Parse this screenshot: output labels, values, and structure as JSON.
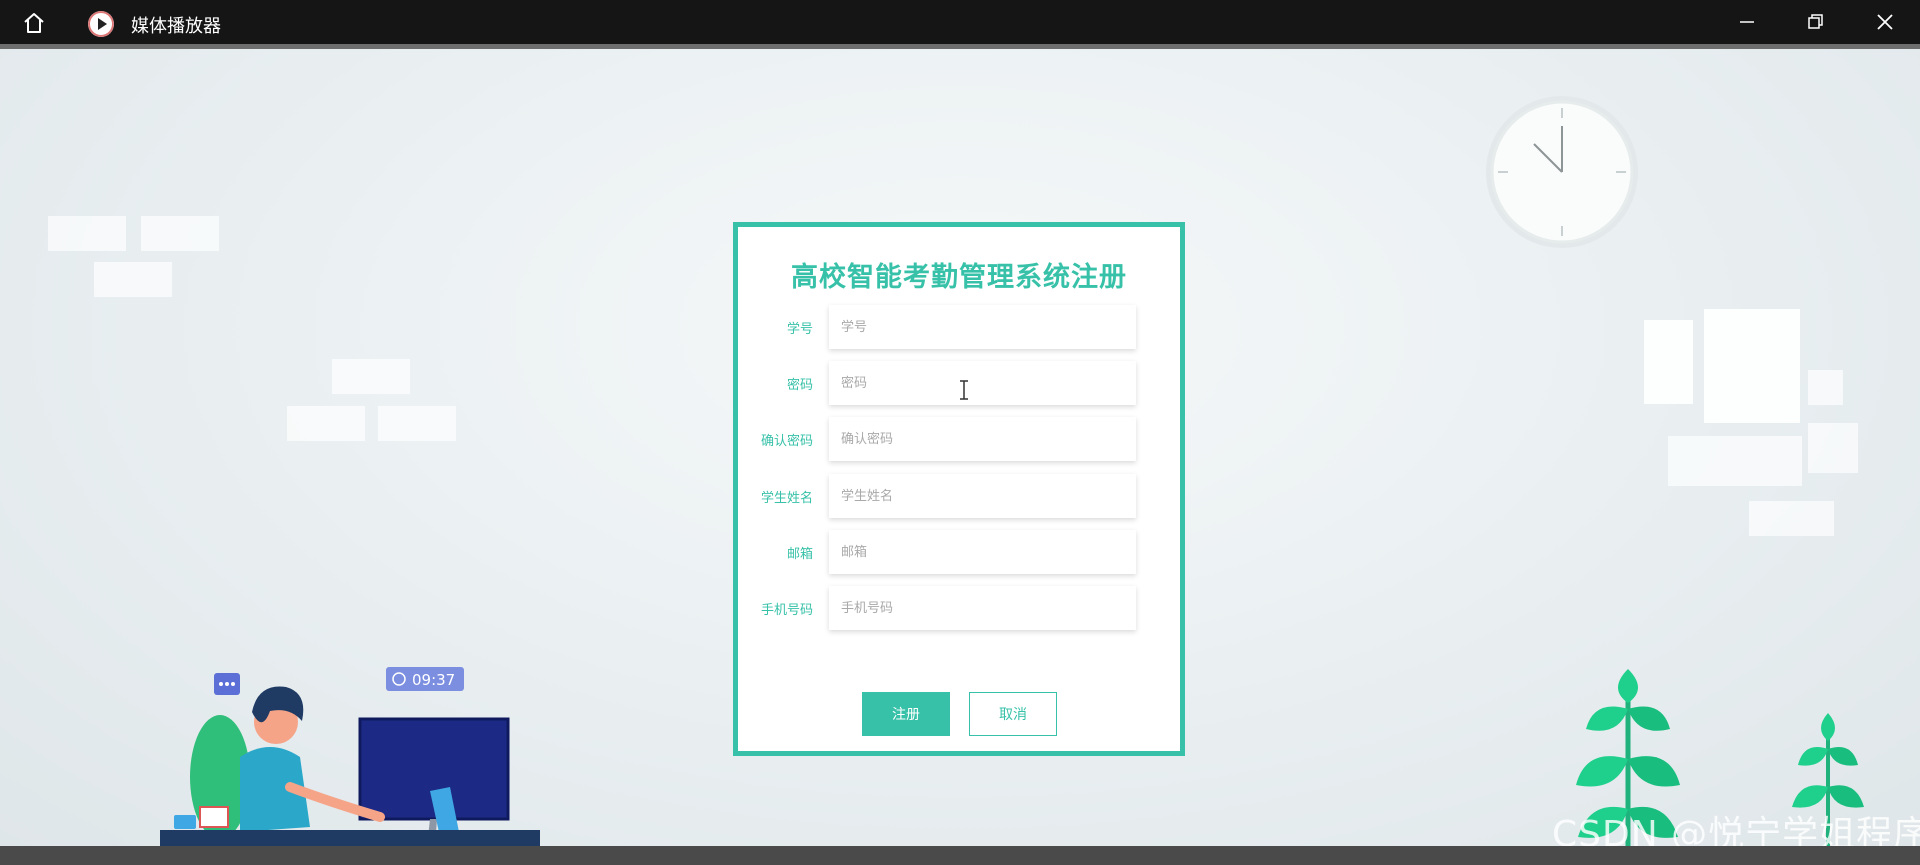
{
  "window": {
    "title": "媒体播放器"
  },
  "form": {
    "title": "高校智能考勤管理系统注册",
    "fields": [
      {
        "label": "学号",
        "placeholder": "学号"
      },
      {
        "label": "密码",
        "placeholder": "密码"
      },
      {
        "label": "确认密码",
        "placeholder": "确认密码"
      },
      {
        "label": "学生姓名",
        "placeholder": "学生姓名"
      },
      {
        "label": "邮箱",
        "placeholder": "邮箱"
      },
      {
        "label": "手机号码",
        "placeholder": "手机号码"
      }
    ],
    "register_label": "注册",
    "cancel_label": "取消"
  },
  "illustration": {
    "time_badge": "09:37"
  },
  "watermark": "CSDN @悦宁学姐程序",
  "colors": {
    "accent": "#37c1a8",
    "titlebar": "#151515"
  }
}
